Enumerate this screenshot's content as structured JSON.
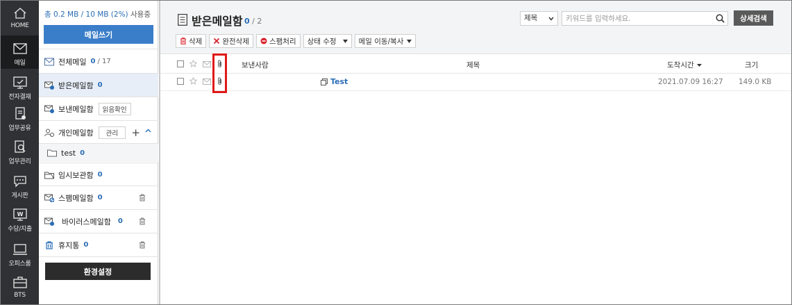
{
  "rail": {
    "items": [
      {
        "label": "HOME",
        "icon": "home-icon"
      },
      {
        "label": "메일",
        "icon": "mail-icon"
      },
      {
        "label": "전자결재",
        "icon": "approval-icon"
      },
      {
        "label": "업무공유",
        "icon": "share-icon"
      },
      {
        "label": "업무관리",
        "icon": "task-icon"
      },
      {
        "label": "게시판",
        "icon": "board-icon"
      },
      {
        "label": "수당/지출",
        "icon": "expense-icon"
      },
      {
        "label": "오피스룸",
        "icon": "office-icon"
      },
      {
        "label": "BTS",
        "icon": "bts-icon"
      }
    ]
  },
  "sidebar": {
    "quota": {
      "used_text": "총 0.2 MB / 10 MB (2%)",
      "suffix": "사용중"
    },
    "compose_label": "메일쓰기",
    "folders": {
      "all": {
        "label": "전체메일",
        "count": "0",
        "total": "/ 17"
      },
      "inbox": {
        "label": "받은메일함",
        "count": "0"
      },
      "sent": {
        "label": "보낸메일함",
        "button": "읽음확인"
      },
      "personal": {
        "label": "개인메일함",
        "button": "관리",
        "add": "+"
      },
      "test": {
        "label": "test",
        "count": "0"
      },
      "drafts": {
        "label": "임시보관함",
        "count": "0"
      },
      "spam": {
        "label": "스팸메일함",
        "count": "0"
      },
      "virus": {
        "label": "바이러스메일함",
        "count": "0"
      },
      "trash": {
        "label": "휴지통",
        "count": "0"
      }
    },
    "settings_label": "환경설정"
  },
  "main": {
    "title": "받은메일함",
    "count_unread": "0",
    "count_total": "/ 2",
    "search": {
      "field": "제목",
      "placeholder": "키워드를 입력하세요.",
      "advanced_label": "상세검색"
    },
    "toolbar": {
      "delete": "삭제",
      "perm_delete": "완전삭제",
      "spam": "스팸처리",
      "status": "상태 수정",
      "move": "메일 이동/복사"
    },
    "columns": {
      "sender": "보낸사람",
      "subject": "제목",
      "received": "도착시간",
      "size": "크기"
    },
    "rows": [
      {
        "sender": "",
        "subject": "Test",
        "received": "2021.07.09 16:27",
        "size": "149.0 KB"
      }
    ]
  },
  "colors": {
    "rail_bg": "#2f3134",
    "accent_blue": "#3a7dc9",
    "highlight_red": "#e01818"
  }
}
